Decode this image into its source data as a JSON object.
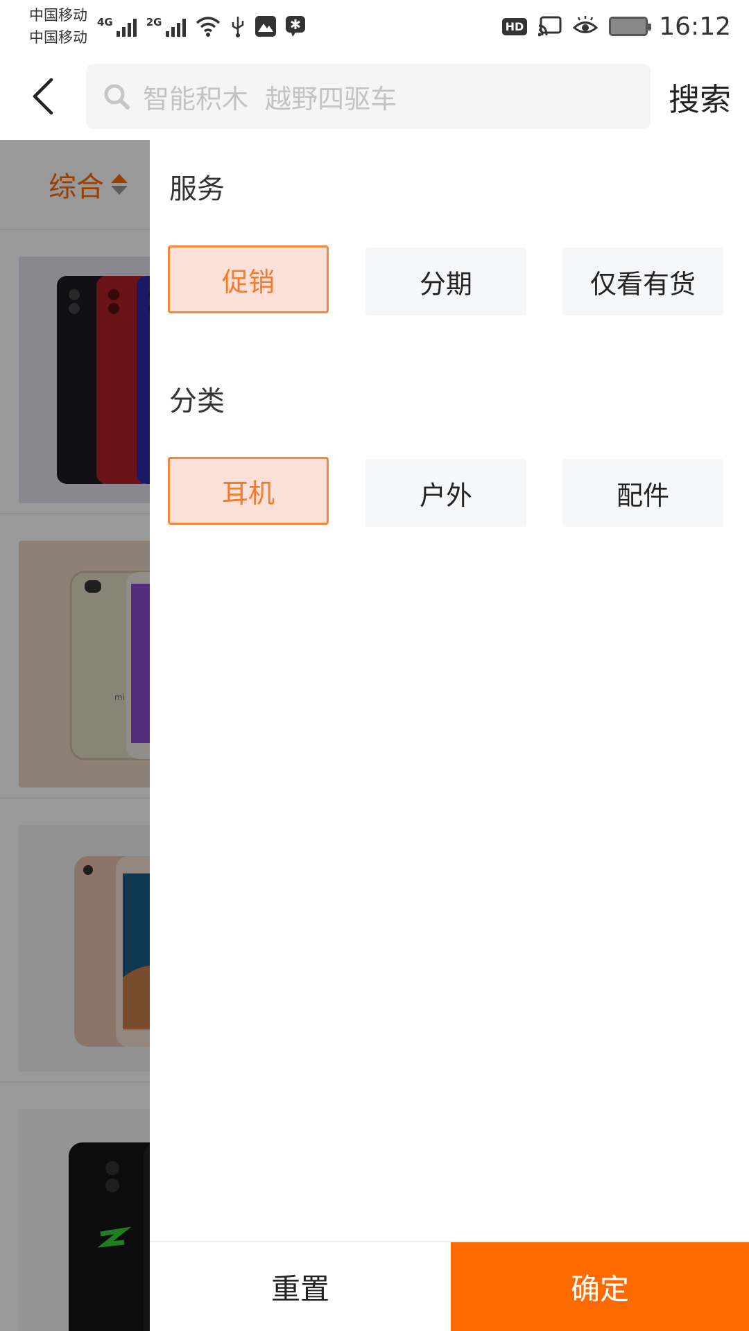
{
  "status_bar": {
    "carrier_1": "中国移动",
    "carrier_2": "中国移动",
    "network_1": "4G",
    "network_2": "2G",
    "hd_badge": "HD",
    "time": "16:12"
  },
  "header": {
    "search_placeholder": "智能积木  越野四驱车",
    "search_button": "搜索"
  },
  "sort_bar": {
    "label": "综合"
  },
  "products": [
    {
      "thumb_color": "#e4e3f2",
      "icon": "phone-image"
    },
    {
      "thumb_color": "#ead7c2",
      "icon": "phone-image"
    },
    {
      "thumb_color": "#f4f4f4",
      "icon": "phone-image"
    },
    {
      "thumb_color": "#f7f7f7",
      "icon": "phone-image"
    }
  ],
  "filter": {
    "service_title": "服务",
    "service_options": [
      {
        "label": "促销",
        "selected": true
      },
      {
        "label": "分期",
        "selected": false
      },
      {
        "label": "仅看有货",
        "selected": false
      }
    ],
    "category_title": "分类",
    "category_options": [
      {
        "label": "耳机",
        "selected": true
      },
      {
        "label": "户外",
        "selected": false
      },
      {
        "label": "配件",
        "selected": false
      }
    ],
    "reset_label": "重置",
    "confirm_label": "确定"
  },
  "colors": {
    "accent": "#ff6a00",
    "selected_bg": "#fde0d8",
    "selected_border": "#f5863a"
  }
}
